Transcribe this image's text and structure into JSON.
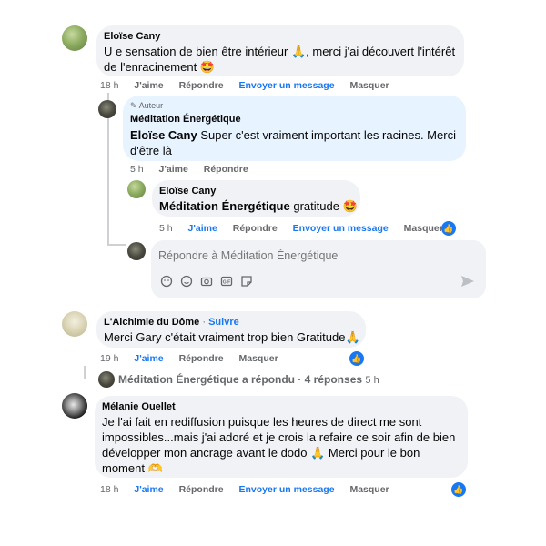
{
  "comments": [
    {
      "author": "Eloïse Cany",
      "text_line1": "U e sensation de bien être intérieur 🙏, merci j'ai découvert l'intérêt",
      "text_line2": "de l'enracinement 🤩",
      "time": "18 h",
      "actions": [
        "J'aime",
        "Répondre",
        "Envoyer un message",
        "Masquer"
      ]
    },
    {
      "badge": "Auteur",
      "author": "Méditation Énergétique",
      "mention": "Eloïse Cany",
      "text_line1_rest": " Super c'est vraiment important les racines. Merci",
      "text_line2": "d'être là",
      "time": "5 h",
      "actions": [
        "J'aime",
        "Répondre"
      ]
    },
    {
      "author": "Eloïse Cany",
      "mention": "Méditation Énergétique",
      "text_rest": " gratitude 🤩",
      "time": "5 h",
      "actions": [
        "J'aime",
        "Répondre",
        "Envoyer un message",
        "Masquer"
      ]
    },
    {
      "author": "L'Alchimie du Dôme",
      "follow": "Suivre",
      "text": "Merci Gary c'était vraiment trop bien Gratitude🙏",
      "time": "19 h",
      "actions": [
        "J'aime",
        "Répondre",
        "Masquer"
      ]
    },
    {
      "author": "Mélanie Ouellet",
      "lines": [
        "Je l'ai fait en rediffusion puisque les heures de direct me sont",
        "impossibles...mais j'ai adoré et je crois la refaire ce soir afin de bien",
        "développer mon ancrage avant le dodo 🙏 Merci pour le bon",
        "moment 🫶"
      ],
      "time": "18 h",
      "actions": [
        "J'aime",
        "Répondre",
        "Envoyer un message",
        "Masquer"
      ]
    }
  ],
  "reply_box": {
    "placeholder": "Répondre à Méditation Énergétique"
  },
  "replies_summary": {
    "text": "Méditation Énergétique a répondu · 4 réponses",
    "time": "5 h"
  },
  "colors": {
    "accent": "#1877f2",
    "bubble": "#f0f2f5",
    "author_bubble": "#e7f3ff",
    "secondary_text": "#65676b"
  },
  "icons": [
    "pencil-icon",
    "like-icon",
    "avatar-sticker-icon",
    "emoji-icon",
    "camera-icon",
    "gif-icon",
    "sticker-icon",
    "send-icon"
  ]
}
